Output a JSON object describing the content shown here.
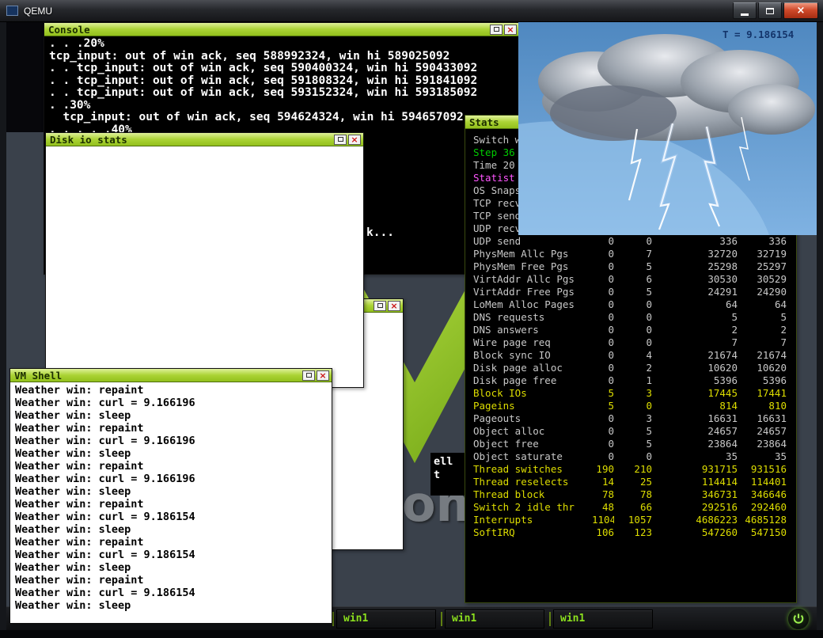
{
  "qemu_window": {
    "title": "QEMU"
  },
  "icons": {
    "close_glyph": "×"
  },
  "desktop": {
    "logo_text": "om",
    "taskbar": {
      "buttons": [
        {
          "label": "win1"
        },
        {
          "label": "win1"
        },
        {
          "label": "win1"
        }
      ]
    }
  },
  "console_window": {
    "title": "Console",
    "lines": [
      ". . .20%",
      "tcp_input: out of win ack, seq 588992324, win hi 589025092",
      ". . tcp_input: out of win ack, seq 590400324, win hi 590433092",
      ". . tcp_input: out of win ack, seq 591808324, win hi 591841092",
      ". . tcp_input: out of win ack, seq 593152324, win hi 593185092",
      ". .30%",
      "  tcp_input: out of win ack, seq 594624324, win hi 594657092",
      ". . . . .40%"
    ],
    "fragment": "k..."
  },
  "disk_io_window": {
    "title": "Disk io stats"
  },
  "vm_shell_window": {
    "title": "VM Shell",
    "lines": [
      "Weather win: repaint",
      "Weather win: curl = 9.166196",
      "Weather win: sleep",
      "Weather win: repaint",
      "Weather win: curl = 9.166196",
      "Weather win: sleep",
      "Weather win: repaint",
      "Weather win: curl = 9.166196",
      "Weather win: sleep",
      "Weather win: repaint",
      "Weather win: curl = 9.186154",
      "Weather win: sleep",
      "Weather win: repaint",
      "Weather win: curl = 9.186154",
      "Weather win: sleep",
      "Weather win: repaint",
      "Weather win: curl = 9.186154",
      "Weather win: sleep"
    ]
  },
  "stats_window": {
    "title": "Stats",
    "partial_rows": [
      {
        "label": "Switch w",
        "color": "dim"
      },
      {
        "label": "Step 36",
        "color": "green"
      },
      {
        "label": "Time 20",
        "color": "dim"
      },
      {
        "label": "Statist",
        "color": "magenta"
      },
      {
        "label": "OS Snaps",
        "color": "dim"
      },
      {
        "label": "TCP recv",
        "color": "dim"
      },
      {
        "label": "TCP send",
        "color": "dim"
      },
      {
        "label": "UDP recv",
        "color": "dim"
      }
    ],
    "rows": [
      {
        "label": "UDP send",
        "color": "dim",
        "values": [
          0,
          0,
          336,
          336
        ]
      },
      {
        "label": "PhysMem Allc Pgs",
        "color": "dim",
        "values": [
          0,
          7,
          32720,
          32719
        ]
      },
      {
        "label": "PhysMem Free Pgs",
        "color": "dim",
        "values": [
          0,
          5,
          25298,
          25297
        ]
      },
      {
        "label": "VirtAddr Allc Pgs",
        "color": "dim",
        "values": [
          0,
          6,
          30530,
          30529
        ]
      },
      {
        "label": "VirtAddr Free Pgs",
        "color": "dim",
        "values": [
          0,
          5,
          24291,
          24290
        ]
      },
      {
        "label": "LoMem Alloc Pages",
        "color": "dim",
        "values": [
          0,
          0,
          64,
          64
        ]
      },
      {
        "label": "DNS requests",
        "color": "dim",
        "values": [
          0,
          0,
          5,
          5
        ]
      },
      {
        "label": "DNS answers",
        "color": "dim",
        "values": [
          0,
          0,
          2,
          2
        ]
      },
      {
        "label": "Wire page req",
        "color": "dim",
        "values": [
          0,
          0,
          7,
          7
        ]
      },
      {
        "label": "Block sync IO",
        "color": "dim",
        "values": [
          0,
          4,
          21674,
          21674
        ]
      },
      {
        "label": "Disk page alloc",
        "color": "dim",
        "values": [
          0,
          2,
          10620,
          10620
        ]
      },
      {
        "label": "Disk page free",
        "color": "dim",
        "values": [
          0,
          1,
          5396,
          5396
        ]
      },
      {
        "label": "Block IOs",
        "color": "yellow",
        "values": [
          5,
          3,
          17445,
          17441
        ]
      },
      {
        "label": "Pageins",
        "color": "yellow",
        "values": [
          5,
          0,
          814,
          810
        ]
      },
      {
        "label": "Pageouts",
        "color": "dim",
        "values": [
          0,
          3,
          16631,
          16631
        ]
      },
      {
        "label": "Object alloc",
        "color": "dim",
        "values": [
          0,
          5,
          24657,
          24657
        ]
      },
      {
        "label": "Object free",
        "color": "dim",
        "values": [
          0,
          5,
          23864,
          23864
        ]
      },
      {
        "label": "Object saturate",
        "color": "dim",
        "values": [
          0,
          0,
          35,
          35
        ]
      },
      {
        "label": "Thread switches",
        "color": "yellow",
        "values": [
          190,
          210,
          931715,
          931516
        ]
      },
      {
        "label": "Thread reselects",
        "color": "yellow",
        "values": [
          14,
          25,
          114414,
          114401
        ]
      },
      {
        "label": "Thread block",
        "color": "yellow",
        "values": [
          78,
          78,
          346731,
          346646
        ]
      },
      {
        "label": "Switch 2 idle thr",
        "color": "yellow",
        "values": [
          48,
          66,
          292516,
          292460
        ]
      },
      {
        "label": "Interrupts",
        "color": "yellow",
        "values": [
          1104,
          1057,
          4686223,
          4685128
        ]
      },
      {
        "label": "SoftIRQ",
        "color": "yellow",
        "values": [
          106,
          123,
          547260,
          547150
        ]
      }
    ]
  },
  "weather_window": {
    "temp_label": "T = 9.186154"
  },
  "hidden_window": {
    "fragment_lines": [
      "ell",
      "t"
    ]
  }
}
